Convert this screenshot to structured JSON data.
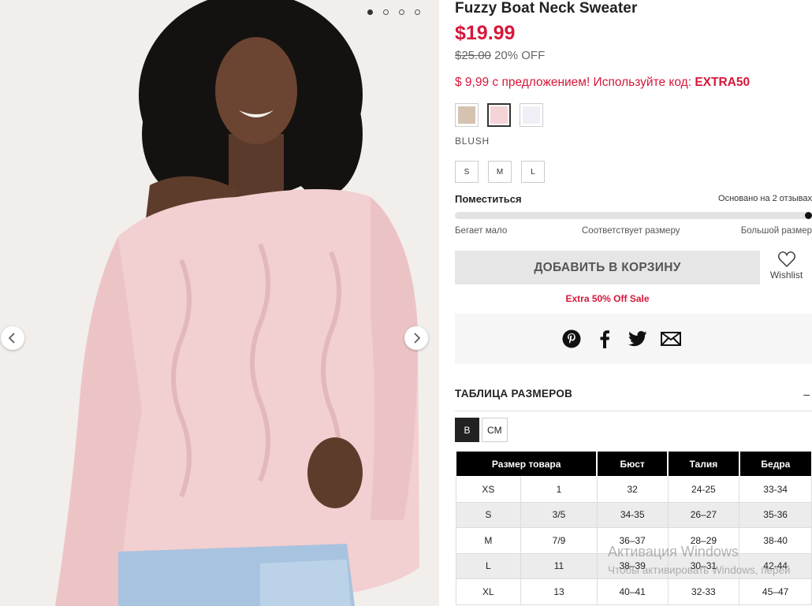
{
  "product": {
    "title": "Fuzzy Boat Neck Sweater",
    "price": "$19.99",
    "old_price": "$25.00",
    "discount": "20% OFF",
    "promo_text": "$ 9,99 с предложением! Используйте код: ",
    "promo_code": "EXTRA50",
    "selected_color": "BLUSH"
  },
  "gallery": {
    "dot_count": 4,
    "active_dot": 0
  },
  "swatches": [
    {
      "name": "taupe",
      "color": "#d6c2b0"
    },
    {
      "name": "blush",
      "color": "#f4d4d6"
    },
    {
      "name": "white",
      "color": "#f0eff5"
    }
  ],
  "sizes": [
    "S",
    "M",
    "L"
  ],
  "fit": {
    "title": "Поместиться",
    "based_on": "Основано на 2 отзывах",
    "label_small": "Бегает мало",
    "label_true": "Соответствует размеру",
    "label_large": "Большой размер",
    "rating_fraction": 1.0
  },
  "actions": {
    "add_to_cart": "ДОБАВИТЬ В КОРЗИНУ",
    "wishlist": "Wishlist",
    "sale_note": "Extra 50% Off Sale"
  },
  "share": {
    "icons": [
      "pinterest-icon",
      "facebook-icon",
      "twitter-icon",
      "email-icon"
    ]
  },
  "size_chart": {
    "title": "ТАБЛИЦА РАЗМЕРОВ",
    "toggle": "–",
    "units": [
      "B",
      "CM"
    ],
    "active_unit": "B",
    "headers": [
      "Размер товара",
      "Бюст",
      "Талия",
      "Бедра"
    ],
    "rows": [
      [
        "XS",
        "1",
        "32",
        "24-25",
        "33-34"
      ],
      [
        "S",
        "3/5",
        "34-35",
        "26–27",
        "35-36"
      ],
      [
        "M",
        "7/9",
        "36–37",
        "28–29",
        "38-40"
      ],
      [
        "L",
        "11",
        "38–39",
        "30–31",
        "42-44"
      ],
      [
        "XL",
        "13",
        "40–41",
        "32-33",
        "45–47"
      ]
    ]
  },
  "watermark": {
    "line1": "Активация Windows",
    "line2": "Чтобы активировать Windows, перей"
  },
  "colors": {
    "accent": "#d6173a",
    "sweater": "#f2cfd0",
    "background": "#f1eeec"
  }
}
